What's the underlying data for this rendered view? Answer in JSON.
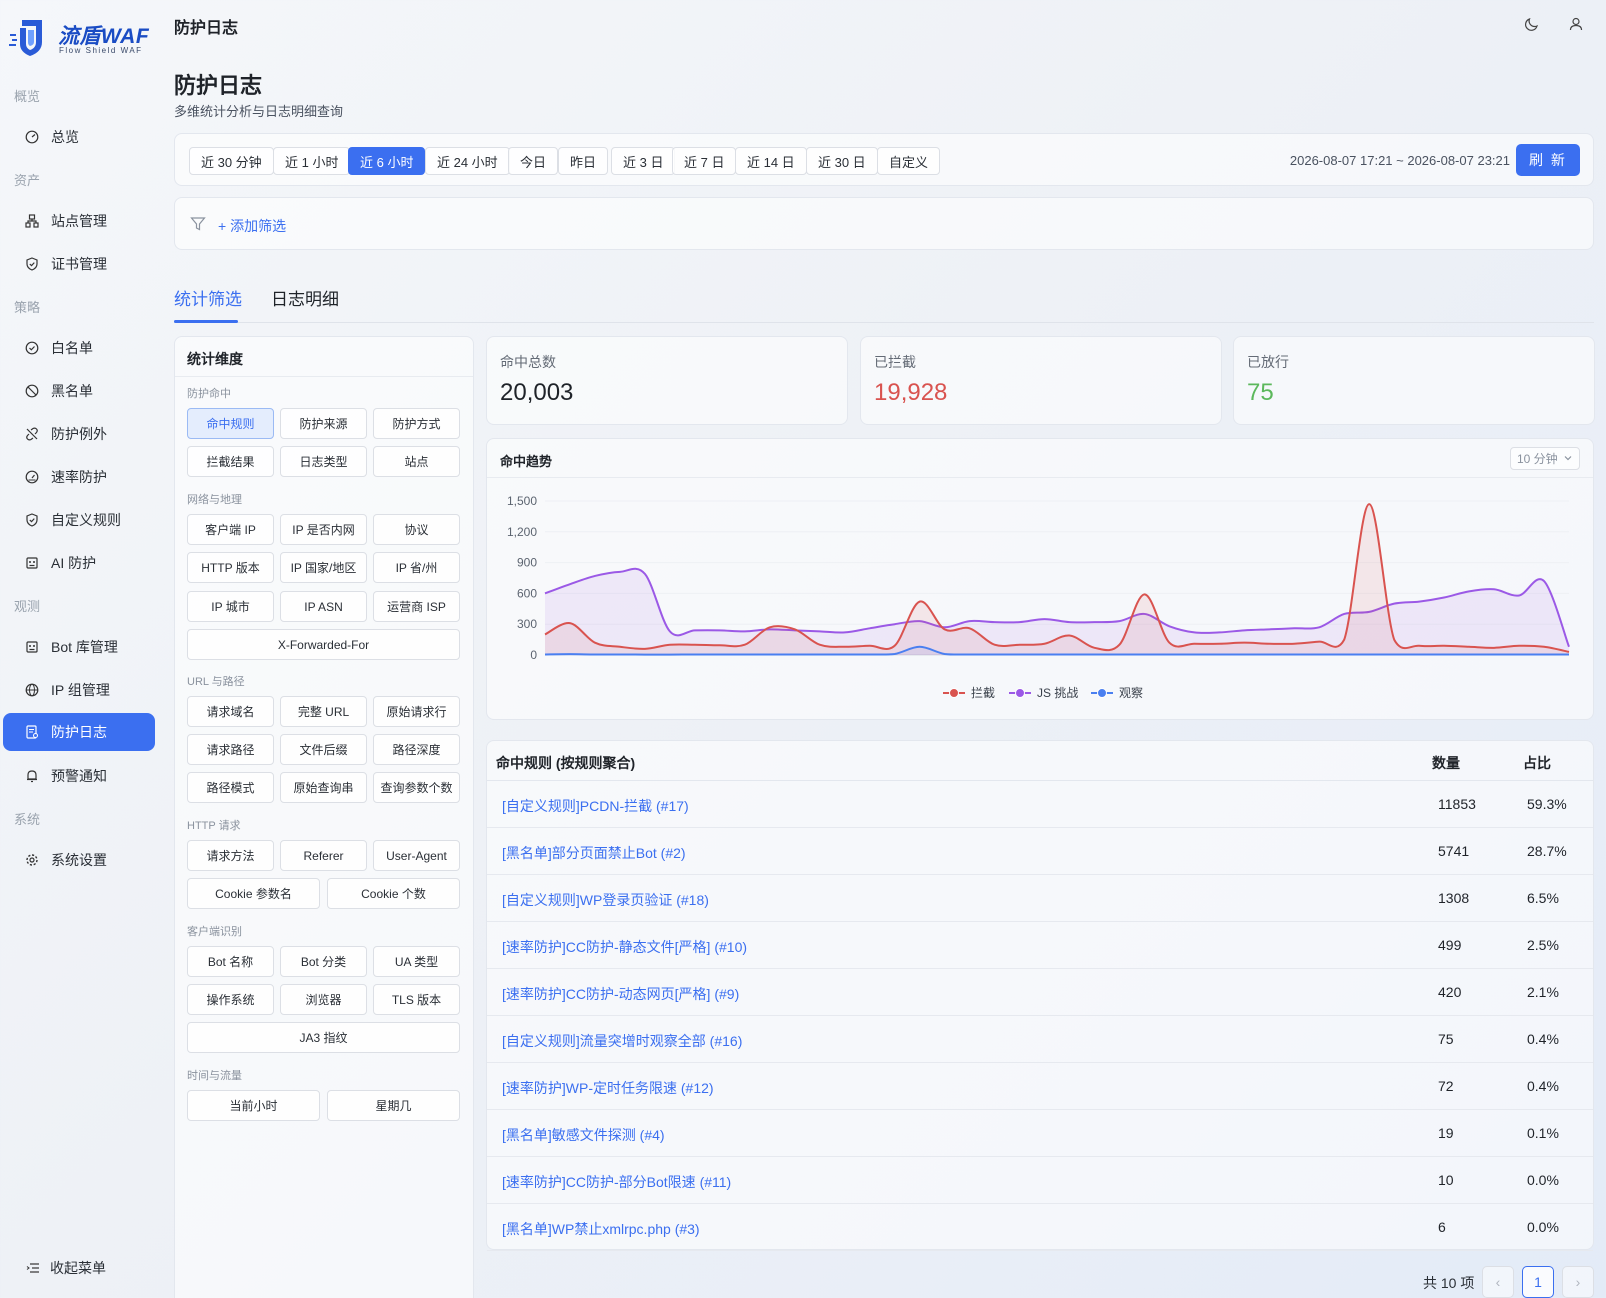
{
  "brand": {
    "name": "流盾WAF",
    "tagline": "Flow Shield WAF"
  },
  "sidebar": {
    "sections": [
      "概览",
      "资产",
      "策略",
      "观测",
      "系统"
    ],
    "items": [
      {
        "label": "总览",
        "icon": "dashboard-icon"
      },
      {
        "label": "站点管理",
        "icon": "sitemap-icon"
      },
      {
        "label": "证书管理",
        "icon": "shield-check-icon"
      },
      {
        "label": "白名单",
        "icon": "check-circle-icon"
      },
      {
        "label": "黑名单",
        "icon": "ban-icon"
      },
      {
        "label": "防护例外",
        "icon": "link-broken-icon"
      },
      {
        "label": "速率防护",
        "icon": "gauge-icon"
      },
      {
        "label": "自定义规则",
        "icon": "shield-check-icon"
      },
      {
        "label": "AI 防护",
        "icon": "robot-icon"
      },
      {
        "label": "Bot 库管理",
        "icon": "robot-icon"
      },
      {
        "label": "IP 组管理",
        "icon": "globe-icon"
      },
      {
        "label": "防护日志",
        "icon": "log-icon",
        "active": true
      },
      {
        "label": "预警通知",
        "icon": "bell-icon"
      },
      {
        "label": "系统设置",
        "icon": "gear-icon"
      }
    ],
    "collapse_label": "收起菜单"
  },
  "header": {
    "title": "防护日志",
    "theme_icon": "moon-icon",
    "user_icon": "user-icon"
  },
  "page": {
    "title": "防护日志",
    "subtitle": "多维统计分析与日志明细查询"
  },
  "time_range": {
    "options": [
      "近 30 分钟",
      "近 1 小时",
      "近 6 小时",
      "近 24 小时",
      "今日",
      "昨日",
      "近 3 日",
      "近 7 日",
      "近 14 日",
      "近 30 日",
      "自定义"
    ],
    "selected": "近 6 小时",
    "range_text": "2026-08-07 17:21 ~ 2026-08-07 23:21",
    "refresh_label": "刷 新"
  },
  "filter": {
    "add_label": "+ 添加筛选"
  },
  "tabs": [
    {
      "label": "统计筛选",
      "active": true
    },
    {
      "label": "日志明细"
    }
  ],
  "dimensions": {
    "title": "统计维度",
    "groups": [
      {
        "name": "防护命中",
        "items": [
          "命中规则",
          "防护来源",
          "防护方式",
          "拦截结果",
          "日志类型",
          "站点"
        ]
      },
      {
        "name": "网络与地理",
        "items": [
          "客户端 IP",
          "IP 是否内网",
          "协议",
          "HTTP 版本",
          "IP 国家/地区",
          "IP 省/州",
          "IP 城市",
          "IP ASN",
          "运营商 ISP",
          "X-Forwarded-For"
        ]
      },
      {
        "name": "URL 与路径",
        "items": [
          "请求域名",
          "完整 URL",
          "原始请求行",
          "请求路径",
          "文件后缀",
          "路径深度",
          "路径模式",
          "原始查询串",
          "查询参数个数"
        ]
      },
      {
        "name": "HTTP 请求",
        "items": [
          "请求方法",
          "Referer",
          "User-Agent",
          "Cookie 参数名",
          "Cookie 个数"
        ]
      },
      {
        "name": "客户端识别",
        "items": [
          "Bot 名称",
          "Bot 分类",
          "UA 类型",
          "操作系统",
          "浏览器",
          "TLS 版本",
          "JA3 指纹"
        ]
      },
      {
        "name": "时间与流量",
        "items": [
          "当前小时",
          "星期几"
        ]
      }
    ],
    "selected": "命中规则"
  },
  "stats": [
    {
      "label": "命中总数",
      "value": "20,003",
      "color": "#1f2329"
    },
    {
      "label": "已拦截",
      "value": "19,928",
      "color": "#d9534f"
    },
    {
      "label": "已放行",
      "value": "75",
      "color": "#5cb85c"
    }
  ],
  "trend": {
    "title": "命中趋势",
    "interval": "10 分钟"
  },
  "chart_data": {
    "type": "area",
    "ylim": [
      0,
      1500
    ],
    "yticks": [
      "0",
      "300",
      "600",
      "900",
      "1,200",
      "1,500"
    ],
    "legend_position": "bottom-center",
    "series": [
      {
        "name": "拦截",
        "color": "#d9534f",
        "values": [
          200,
          310,
          120,
          80,
          60,
          100,
          100,
          95,
          100,
          270,
          250,
          100,
          80,
          90,
          90,
          520,
          250,
          260,
          100,
          100,
          110,
          190,
          70,
          100,
          590,
          120,
          110,
          110,
          120,
          110,
          110,
          130,
          150,
          1470,
          150,
          90,
          90,
          80,
          70,
          90,
          80,
          30
        ]
      },
      {
        "name": "JS 挑战",
        "color": "#9b59e6",
        "values": [
          600,
          690,
          770,
          810,
          790,
          230,
          240,
          240,
          230,
          250,
          240,
          230,
          220,
          260,
          300,
          330,
          270,
          330,
          320,
          320,
          350,
          320,
          320,
          330,
          400,
          280,
          220,
          220,
          240,
          250,
          260,
          270,
          400,
          420,
          500,
          520,
          560,
          620,
          640,
          580,
          720,
          80
        ]
      },
      {
        "name": "观察",
        "color": "#4a7ff0",
        "values": [
          5,
          8,
          5,
          5,
          4,
          4,
          5,
          5,
          5,
          5,
          5,
          5,
          5,
          5,
          10,
          80,
          10,
          5,
          5,
          5,
          5,
          5,
          5,
          5,
          5,
          5,
          5,
          5,
          5,
          5,
          5,
          5,
          5,
          5,
          5,
          5,
          5,
          5,
          5,
          5,
          5,
          5
        ]
      }
    ]
  },
  "rules_table": {
    "columns": [
      "命中规则 (按规则聚合)",
      "数量",
      "占比"
    ],
    "rows": [
      {
        "name": "[自定义规则]PCDN-拦截 (#17)",
        "count": "11853",
        "pct": "59.3%"
      },
      {
        "name": "[黑名单]部分页面禁止Bot (#2)",
        "count": "5741",
        "pct": "28.7%"
      },
      {
        "name": "[自定义规则]WP登录页验证 (#18)",
        "count": "1308",
        "pct": "6.5%"
      },
      {
        "name": "[速率防护]CC防护-静态文件[严格] (#10)",
        "count": "499",
        "pct": "2.5%"
      },
      {
        "name": "[速率防护]CC防护-动态网页[严格] (#9)",
        "count": "420",
        "pct": "2.1%"
      },
      {
        "name": "[自定义规则]流量突增时观察全部 (#16)",
        "count": "75",
        "pct": "0.4%"
      },
      {
        "name": "[速率防护]WP-定时任务限速 (#12)",
        "count": "72",
        "pct": "0.4%"
      },
      {
        "name": "[黑名单]敏感文件探测 (#4)",
        "count": "19",
        "pct": "0.1%"
      },
      {
        "name": "[速率防护]CC防护-部分Bot限速 (#11)",
        "count": "10",
        "pct": "0.0%"
      },
      {
        "name": "[黑名单]WP禁止xmlrpc.php (#3)",
        "count": "6",
        "pct": "0.0%"
      }
    ]
  },
  "pagination": {
    "total_label": "共 10 项",
    "current": "1",
    "prev": "‹",
    "next": "›"
  }
}
